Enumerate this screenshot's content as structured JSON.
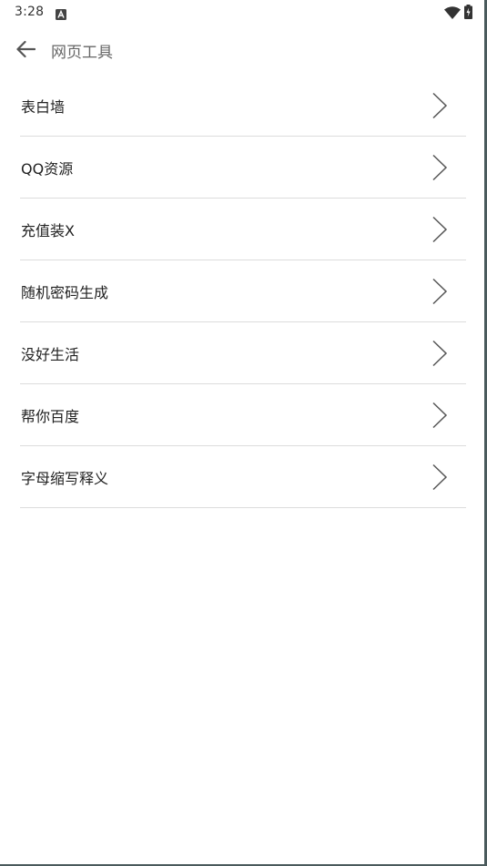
{
  "status_bar": {
    "time": "3:28",
    "notification_icon": "a-box-icon",
    "wifi_icon": "wifi-icon",
    "battery_icon": "battery-charging-icon"
  },
  "app_bar": {
    "back_icon": "arrow-left-icon",
    "title": "网页工具"
  },
  "list": {
    "items": [
      {
        "label": "表白墙"
      },
      {
        "label": "QQ资源"
      },
      {
        "label": "充值装X"
      },
      {
        "label": "随机密码生成"
      },
      {
        "label": "没好生活"
      },
      {
        "label": "帮你百度"
      },
      {
        "label": "字母缩写释义"
      }
    ],
    "chevron_icon": "chevron-right-icon"
  },
  "colors": {
    "text_primary": "#222222",
    "text_secondary": "#666666",
    "divider": "#dcdcdc",
    "background": "#ffffff"
  }
}
